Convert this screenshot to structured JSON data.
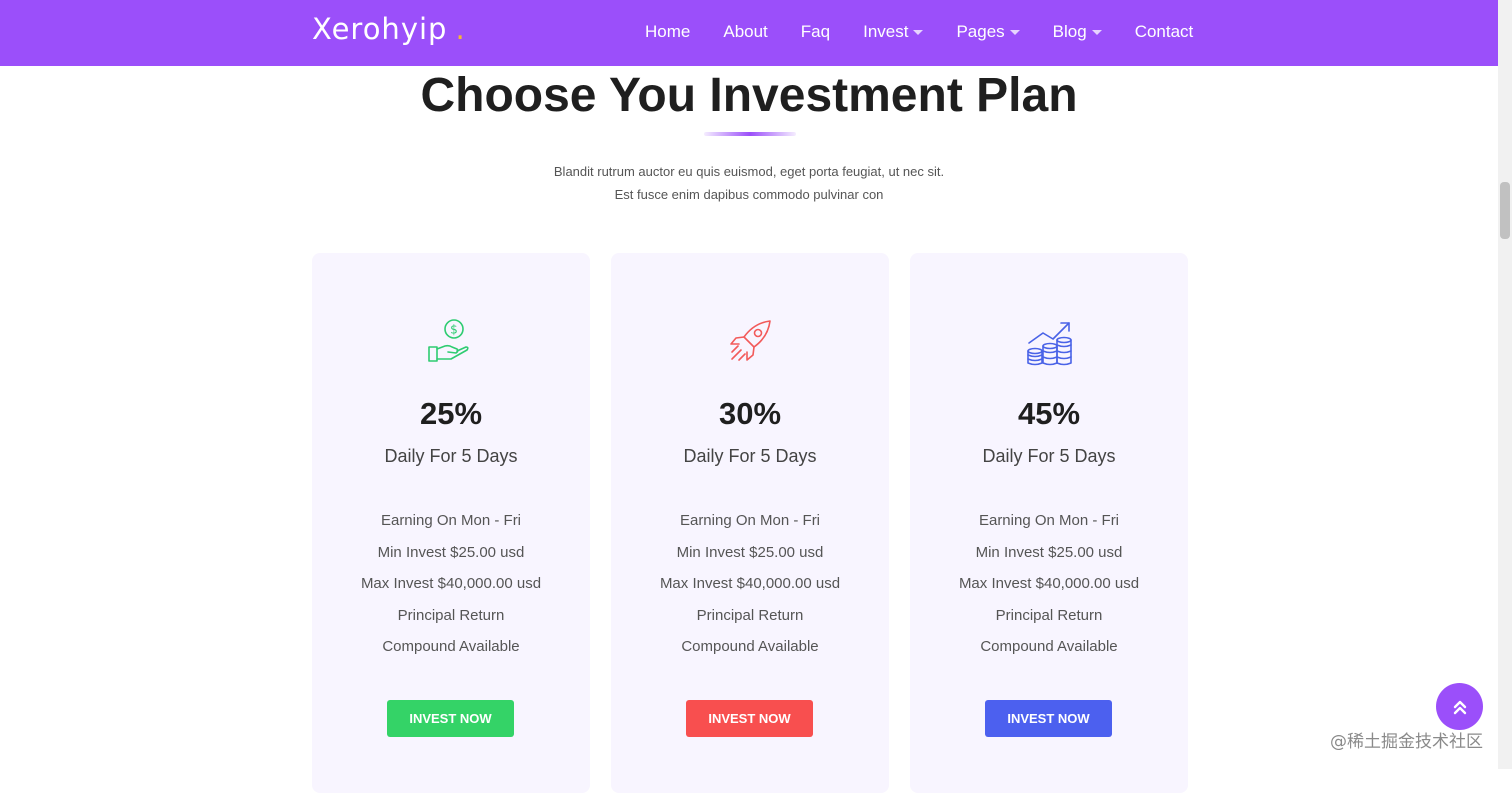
{
  "header": {
    "brand": "Xerohyip",
    "brand_dot": ".",
    "nav": [
      {
        "label": "Home",
        "dropdown": false
      },
      {
        "label": "About",
        "dropdown": false
      },
      {
        "label": "Faq",
        "dropdown": false
      },
      {
        "label": "Invest",
        "dropdown": true
      },
      {
        "label": "Pages",
        "dropdown": true
      },
      {
        "label": "Blog",
        "dropdown": true
      },
      {
        "label": "Contact",
        "dropdown": false
      }
    ]
  },
  "section": {
    "title": "Choose You Investment Plan",
    "subtitle_line1": "Blandit rutrum auctor eu quis euismod, eget porta feugiat, ut nec sit.",
    "subtitle_line2": "Est fusce enim dapibus commodo pulvinar con"
  },
  "plans": [
    {
      "icon": "money-hand-icon",
      "icon_color": "#2ecc71",
      "rate": "25%",
      "period": "Daily For 5 Days",
      "features": [
        "Earning On Mon - Fri",
        "Min Invest $25.00 usd",
        "Max Invest $40,000.00 usd",
        "Principal Return",
        "Compound Available"
      ],
      "button_label": "INVEST NOW",
      "button_color": "#34d367"
    },
    {
      "icon": "rocket-icon",
      "icon_color": "#f25a5a",
      "rate": "30%",
      "period": "Daily For 5 Days",
      "features": [
        "Earning On Mon - Fri",
        "Min Invest $25.00 usd",
        "Max Invest $40,000.00 usd",
        "Principal Return",
        "Compound Available"
      ],
      "button_label": "INVEST NOW",
      "button_color": "#f84f4f"
    },
    {
      "icon": "coins-growth-icon",
      "icon_color": "#4a63e7",
      "rate": "45%",
      "period": "Daily For 5 Days",
      "features": [
        "Earning On Mon - Fri",
        "Min Invest $25.00 usd",
        "Max Invest $40,000.00 usd",
        "Principal Return",
        "Compound Available"
      ],
      "button_label": "INVEST NOW",
      "button_color": "#4c60ef"
    }
  ],
  "back_to_top_icon": "double-chevron-up-icon",
  "watermark": "@稀土掘金技术社区",
  "colors": {
    "primary": "#9b4ffa",
    "card_bg": "#f8f5ff",
    "title": "#1f1f1f"
  }
}
